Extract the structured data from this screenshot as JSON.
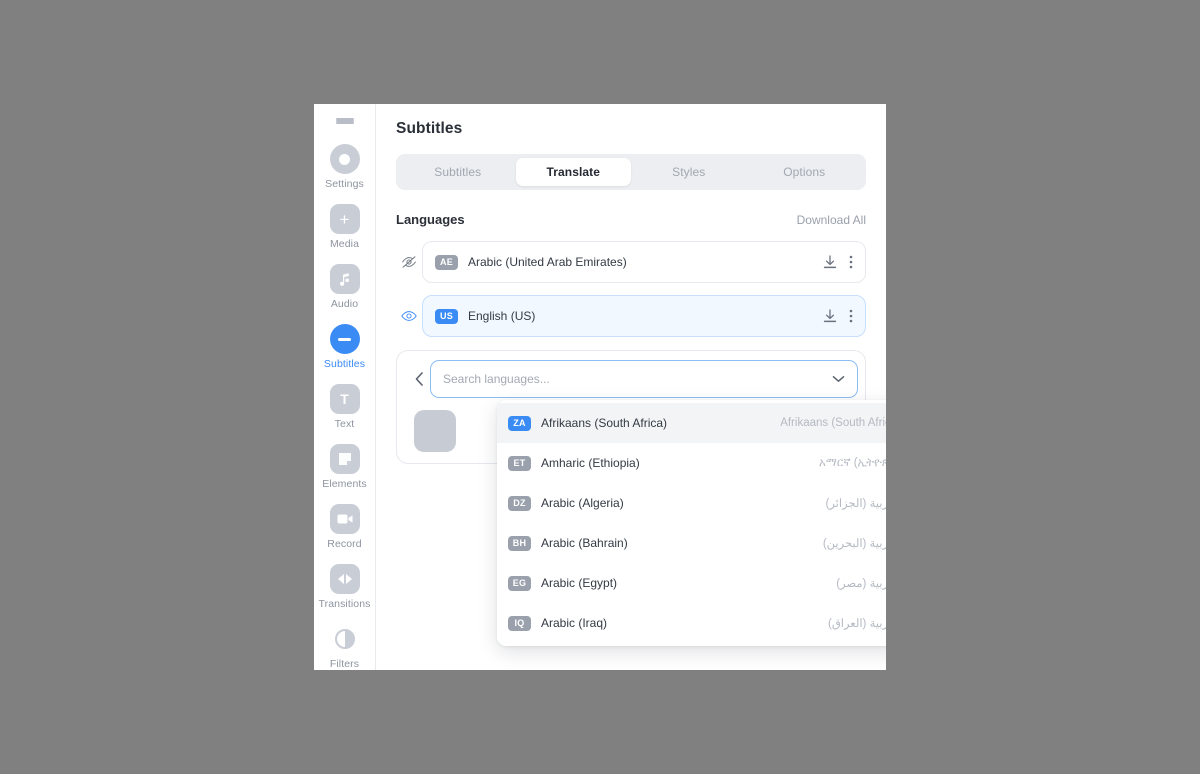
{
  "sidebar": {
    "menu_icon": "hamburger-icon",
    "items": [
      {
        "label": "Settings",
        "icon": "gear-circle-icon",
        "active": false
      },
      {
        "label": "Media",
        "icon": "plus-icon",
        "active": false
      },
      {
        "label": "Audio",
        "icon": "music-note-icon",
        "active": false
      },
      {
        "label": "Subtitles",
        "icon": "subtitle-icon",
        "active": true
      },
      {
        "label": "Text",
        "icon": "text-t-icon",
        "active": false
      },
      {
        "label": "Elements",
        "icon": "shapes-icon",
        "active": false
      },
      {
        "label": "Record",
        "icon": "video-camera-icon",
        "active": false
      },
      {
        "label": "Transitions",
        "icon": "transitions-icon",
        "active": false
      },
      {
        "label": "Filters",
        "icon": "contrast-circle-icon",
        "active": false
      }
    ]
  },
  "main": {
    "page_title": "Subtitles",
    "tabs": [
      {
        "label": "Subtitles",
        "active": false
      },
      {
        "label": "Translate",
        "active": true
      },
      {
        "label": "Styles",
        "active": false
      },
      {
        "label": "Options",
        "active": false
      }
    ],
    "section": {
      "title": "Languages",
      "action_label": "Download All"
    },
    "languages": [
      {
        "code": "AE",
        "name": "Arabic (United Arab Emirates)",
        "visible": false,
        "selected": false,
        "eye_icon": "eye-off-icon",
        "download_icon": "download-icon",
        "menu_icon": "kebab-menu-icon"
      },
      {
        "code": "US",
        "name": "English (US)",
        "visible": true,
        "selected": true,
        "eye_icon": "eye-icon",
        "download_icon": "download-icon",
        "menu_icon": "kebab-menu-icon"
      }
    ]
  },
  "search": {
    "back_icon": "chevron-left-icon",
    "value": "",
    "placeholder": "Search languages...",
    "chevron_icon": "chevron-down-icon"
  },
  "dropdown": {
    "options": [
      {
        "code": "ZA",
        "name": "Afrikaans (South Africa)",
        "native": "Afrikaans (South Africa)",
        "highlighted": true
      },
      {
        "code": "ET",
        "name": "Amharic (Ethiopia)",
        "native": "አማርኛ (ኢትዮጵያ)",
        "highlighted": false
      },
      {
        "code": "DZ",
        "name": "Arabic (Algeria)",
        "native": "العربية (الجزائر)",
        "highlighted": false
      },
      {
        "code": "BH",
        "name": "Arabic (Bahrain)",
        "native": "العربية (البحرين)",
        "highlighted": false
      },
      {
        "code": "EG",
        "name": "Arabic (Egypt)",
        "native": "العربية (مصر)",
        "highlighted": false
      },
      {
        "code": "IQ",
        "name": "Arabic (Iraq)",
        "native": "العربية (العراق)",
        "highlighted": false
      }
    ]
  },
  "colors": {
    "accent": "#3b8bf5",
    "badge_gray": "#9aa1ac",
    "text_dark": "#2a2f38",
    "text_muted": "#9aa0ab",
    "selected_row_bg": "#f2f8ff",
    "app_backdrop": "#808080"
  }
}
